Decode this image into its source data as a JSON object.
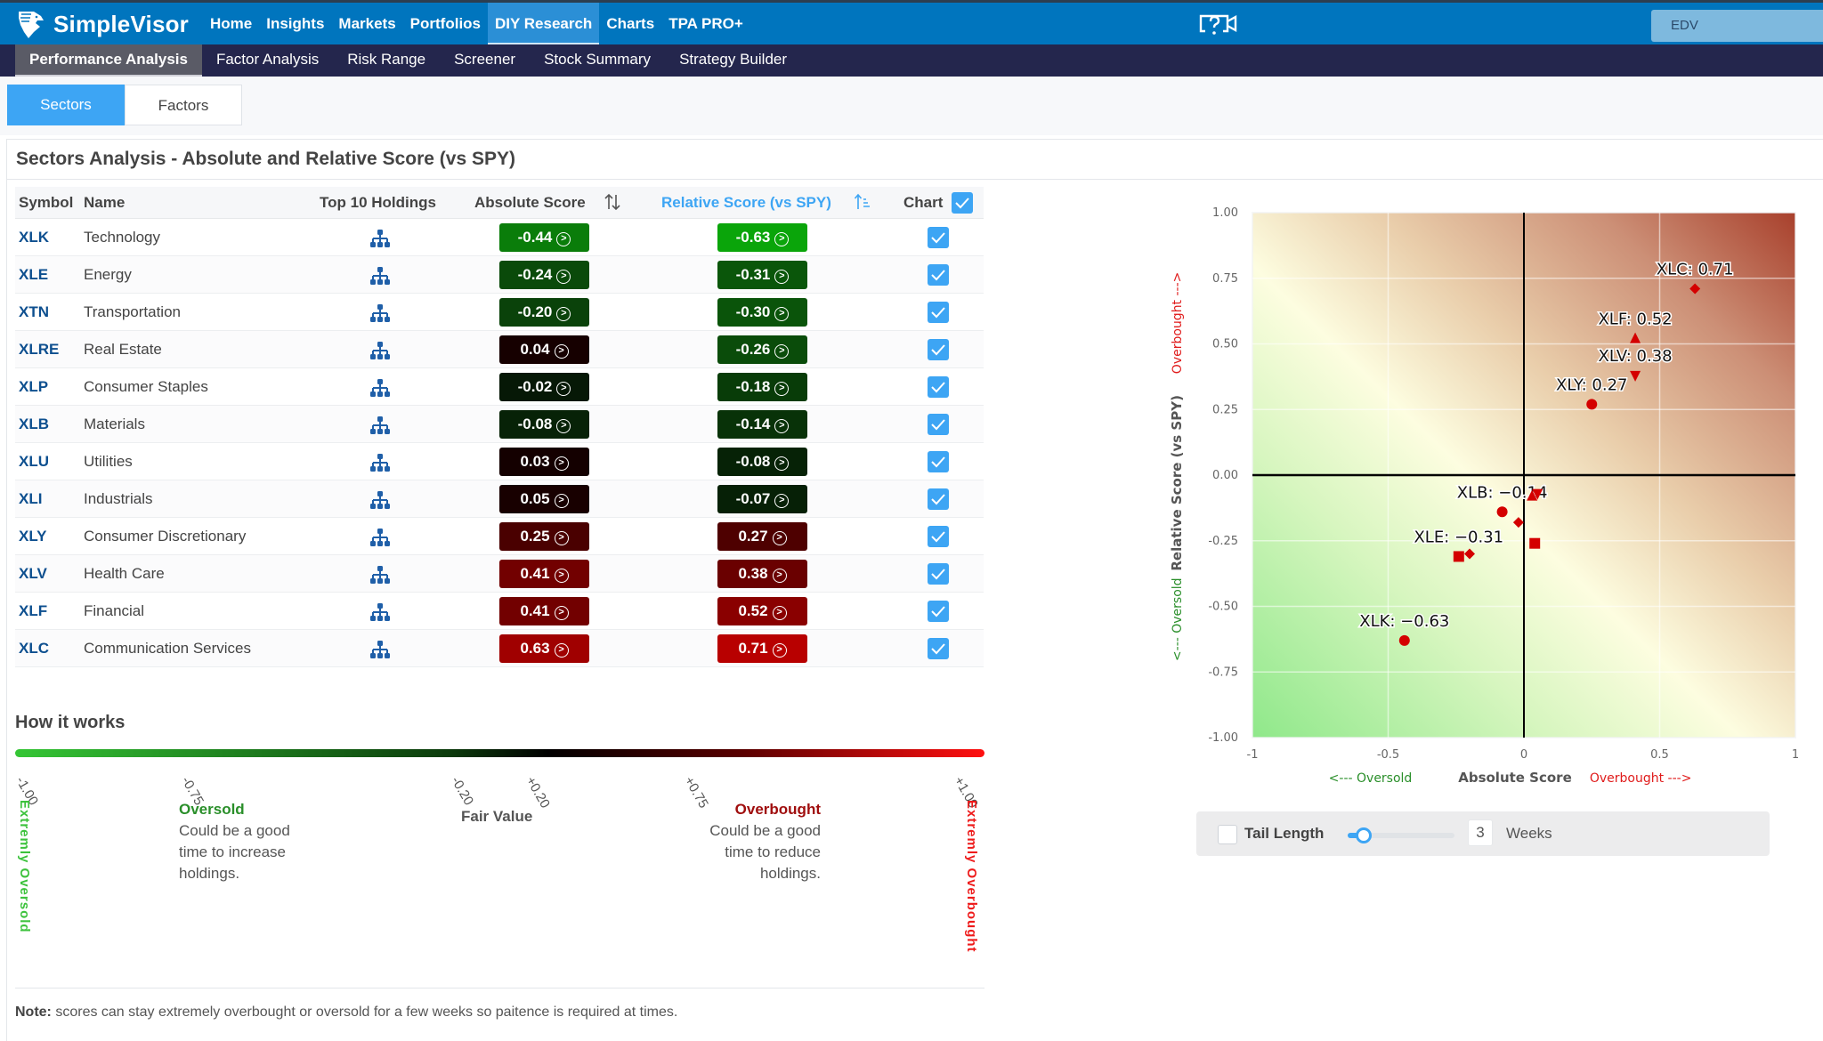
{
  "app": {
    "brand": "SimpleVisor",
    "account_label": "EDV",
    "main_nav": [
      {
        "label": "Home",
        "active": false
      },
      {
        "label": "Insights",
        "active": false
      },
      {
        "label": "Markets",
        "active": false
      },
      {
        "label": "Portfolios",
        "active": false
      },
      {
        "label": "DIY Research",
        "active": true
      },
      {
        "label": "Charts",
        "active": false
      },
      {
        "label": "TPA PRO+",
        "active": false
      }
    ],
    "sub_nav": [
      {
        "label": "Performance Analysis",
        "active": true
      },
      {
        "label": "Factor Analysis",
        "active": false
      },
      {
        "label": "Risk Range",
        "active": false
      },
      {
        "label": "Screener",
        "active": false
      },
      {
        "label": "Stock Summary",
        "active": false
      },
      {
        "label": "Strategy Builder",
        "active": false
      }
    ]
  },
  "tabs": [
    {
      "label": "Sectors",
      "active": true
    },
    {
      "label": "Factors",
      "active": false
    }
  ],
  "panel": {
    "title": "Sectors Analysis - Absolute and Relative Score (vs SPY)"
  },
  "table": {
    "headers": {
      "symbol": "Symbol",
      "name": "Name",
      "holdings": "Top 10 Holdings",
      "absolute": "Absolute Score",
      "relative": "Relative Score (vs SPY)",
      "chart": "Chart"
    },
    "chart_all_checked": true,
    "rows": [
      {
        "symbol": "XLK",
        "name": "Technology",
        "abs": "-0.44",
        "rel": "-0.63",
        "abs_color": "#0a7d0a",
        "rel_color": "#0aa50a",
        "checked": true
      },
      {
        "symbol": "XLE",
        "name": "Energy",
        "abs": "-0.24",
        "rel": "-0.31",
        "abs_color": "#0a4a0a",
        "rel_color": "#0a560a",
        "checked": true
      },
      {
        "symbol": "XTN",
        "name": "Transportation",
        "abs": "-0.20",
        "rel": "-0.30",
        "abs_color": "#0a420a",
        "rel_color": "#0a540a",
        "checked": true
      },
      {
        "symbol": "XLRE",
        "name": "Real Estate",
        "abs": "0.04",
        "rel": "-0.26",
        "abs_color": "#160000",
        "rel_color": "#0a4c0a",
        "checked": true
      },
      {
        "symbol": "XLP",
        "name": "Consumer Staples",
        "abs": "-0.02",
        "rel": "-0.18",
        "abs_color": "#061806",
        "rel_color": "#083c08",
        "checked": true
      },
      {
        "symbol": "XLB",
        "name": "Materials",
        "abs": "-0.08",
        "rel": "-0.14",
        "abs_color": "#072207",
        "rel_color": "#083208",
        "checked": true
      },
      {
        "symbol": "XLU",
        "name": "Utilities",
        "abs": "0.03",
        "rel": "-0.08",
        "abs_color": "#140000",
        "rel_color": "#062206",
        "checked": true
      },
      {
        "symbol": "XLI",
        "name": "Industrials",
        "abs": "0.05",
        "rel": "-0.07",
        "abs_color": "#180000",
        "rel_color": "#062006",
        "checked": true
      },
      {
        "symbol": "XLY",
        "name": "Consumer Discretionary",
        "abs": "0.25",
        "rel": "0.27",
        "abs_color": "#4a0000",
        "rel_color": "#4e0000",
        "checked": true
      },
      {
        "symbol": "XLV",
        "name": "Health Care",
        "abs": "0.41",
        "rel": "0.38",
        "abs_color": "#720000",
        "rel_color": "#6a0000",
        "checked": true
      },
      {
        "symbol": "XLF",
        "name": "Financial",
        "abs": "0.41",
        "rel": "0.52",
        "abs_color": "#720000",
        "rel_color": "#8a0000",
        "checked": true
      },
      {
        "symbol": "XLC",
        "name": "Communication Services",
        "abs": "0.63",
        "rel": "0.71",
        "abs_color": "#a00000",
        "rel_color": "#b80000",
        "checked": true
      }
    ]
  },
  "how_it_works": {
    "title": "How it works",
    "ticks": [
      "-1.00",
      "-0.75",
      "-0.20",
      "+0.20",
      "+0.75",
      "+1.00"
    ],
    "extreme_oversold": "Extremly Oversold",
    "extreme_overbought": "Extremly Overbought",
    "oversold_heading": "Oversold",
    "oversold_text": [
      "Could be a good",
      "time to increase",
      "holdings."
    ],
    "fair_value": "Fair Value",
    "overbought_heading": "Overbought",
    "overbought_text": [
      "Could be a good",
      "time to reduce",
      "holdings."
    ],
    "note_label": "Note:",
    "note_text": " scores can stay extremely overbought or oversold for a few weeks so paitence is required at times."
  },
  "tail": {
    "label": "Tail Length",
    "checked": false,
    "weeks": "3",
    "weeks_label": "Weeks",
    "slider_fraction": 0.15
  },
  "chart_data": {
    "type": "scatter",
    "xlabel": "Absolute Score",
    "xlabel_left": "<--- Oversold",
    "xlabel_right": "Overbought --->",
    "ylabel": "Relative Score (vs SPY)",
    "ylabel_low": "<--- Oversold",
    "ylabel_high": "Overbought --->",
    "xlim": [
      -1,
      1
    ],
    "ylim": [
      -1,
      1
    ],
    "xticks": [
      "-1",
      "-0.5",
      "0",
      "0.5",
      "1"
    ],
    "xtick_values": [
      -1,
      -0.5,
      0,
      0.5,
      1
    ],
    "yticks": [
      "1.00",
      "0.75",
      "0.50",
      "0.25",
      "0.00",
      "-0.25",
      "-0.50",
      "-0.75",
      "-1.00"
    ],
    "ytick_values": [
      1,
      0.75,
      0.5,
      0.25,
      0,
      -0.25,
      -0.5,
      -0.75,
      -1
    ],
    "grid": true,
    "marker_color": "#d40000",
    "points": [
      {
        "symbol": "XLK",
        "x": -0.44,
        "y": -0.63,
        "marker": "circle",
        "label": "XLK: −0.63"
      },
      {
        "symbol": "XLE",
        "x": -0.24,
        "y": -0.31,
        "marker": "square",
        "label": "XLE: −0.31"
      },
      {
        "symbol": "XTN",
        "x": -0.2,
        "y": -0.3,
        "marker": "diamond",
        "label": ""
      },
      {
        "symbol": "XLRE",
        "x": 0.04,
        "y": -0.26,
        "marker": "square",
        "label": ""
      },
      {
        "symbol": "XLP",
        "x": -0.02,
        "y": -0.18,
        "marker": "diamond",
        "label": ""
      },
      {
        "symbol": "XLB",
        "x": -0.08,
        "y": -0.14,
        "marker": "circle",
        "label": "XLB: −0.14"
      },
      {
        "symbol": "XLU",
        "x": 0.03,
        "y": -0.08,
        "marker": "triangle",
        "label": ""
      },
      {
        "symbol": "XLI",
        "x": 0.05,
        "y": -0.07,
        "marker": "triangle-down",
        "label": ""
      },
      {
        "symbol": "XLY",
        "x": 0.25,
        "y": 0.27,
        "marker": "circle",
        "label": "XLY: 0.27"
      },
      {
        "symbol": "XLV",
        "x": 0.41,
        "y": 0.38,
        "marker": "triangle-down",
        "label": "XLV: 0.38"
      },
      {
        "symbol": "XLF",
        "x": 0.41,
        "y": 0.52,
        "marker": "triangle",
        "label": "XLF: 0.52"
      },
      {
        "symbol": "XLC",
        "x": 0.63,
        "y": 0.71,
        "marker": "diamond",
        "label": "XLC: 0.71"
      }
    ]
  }
}
